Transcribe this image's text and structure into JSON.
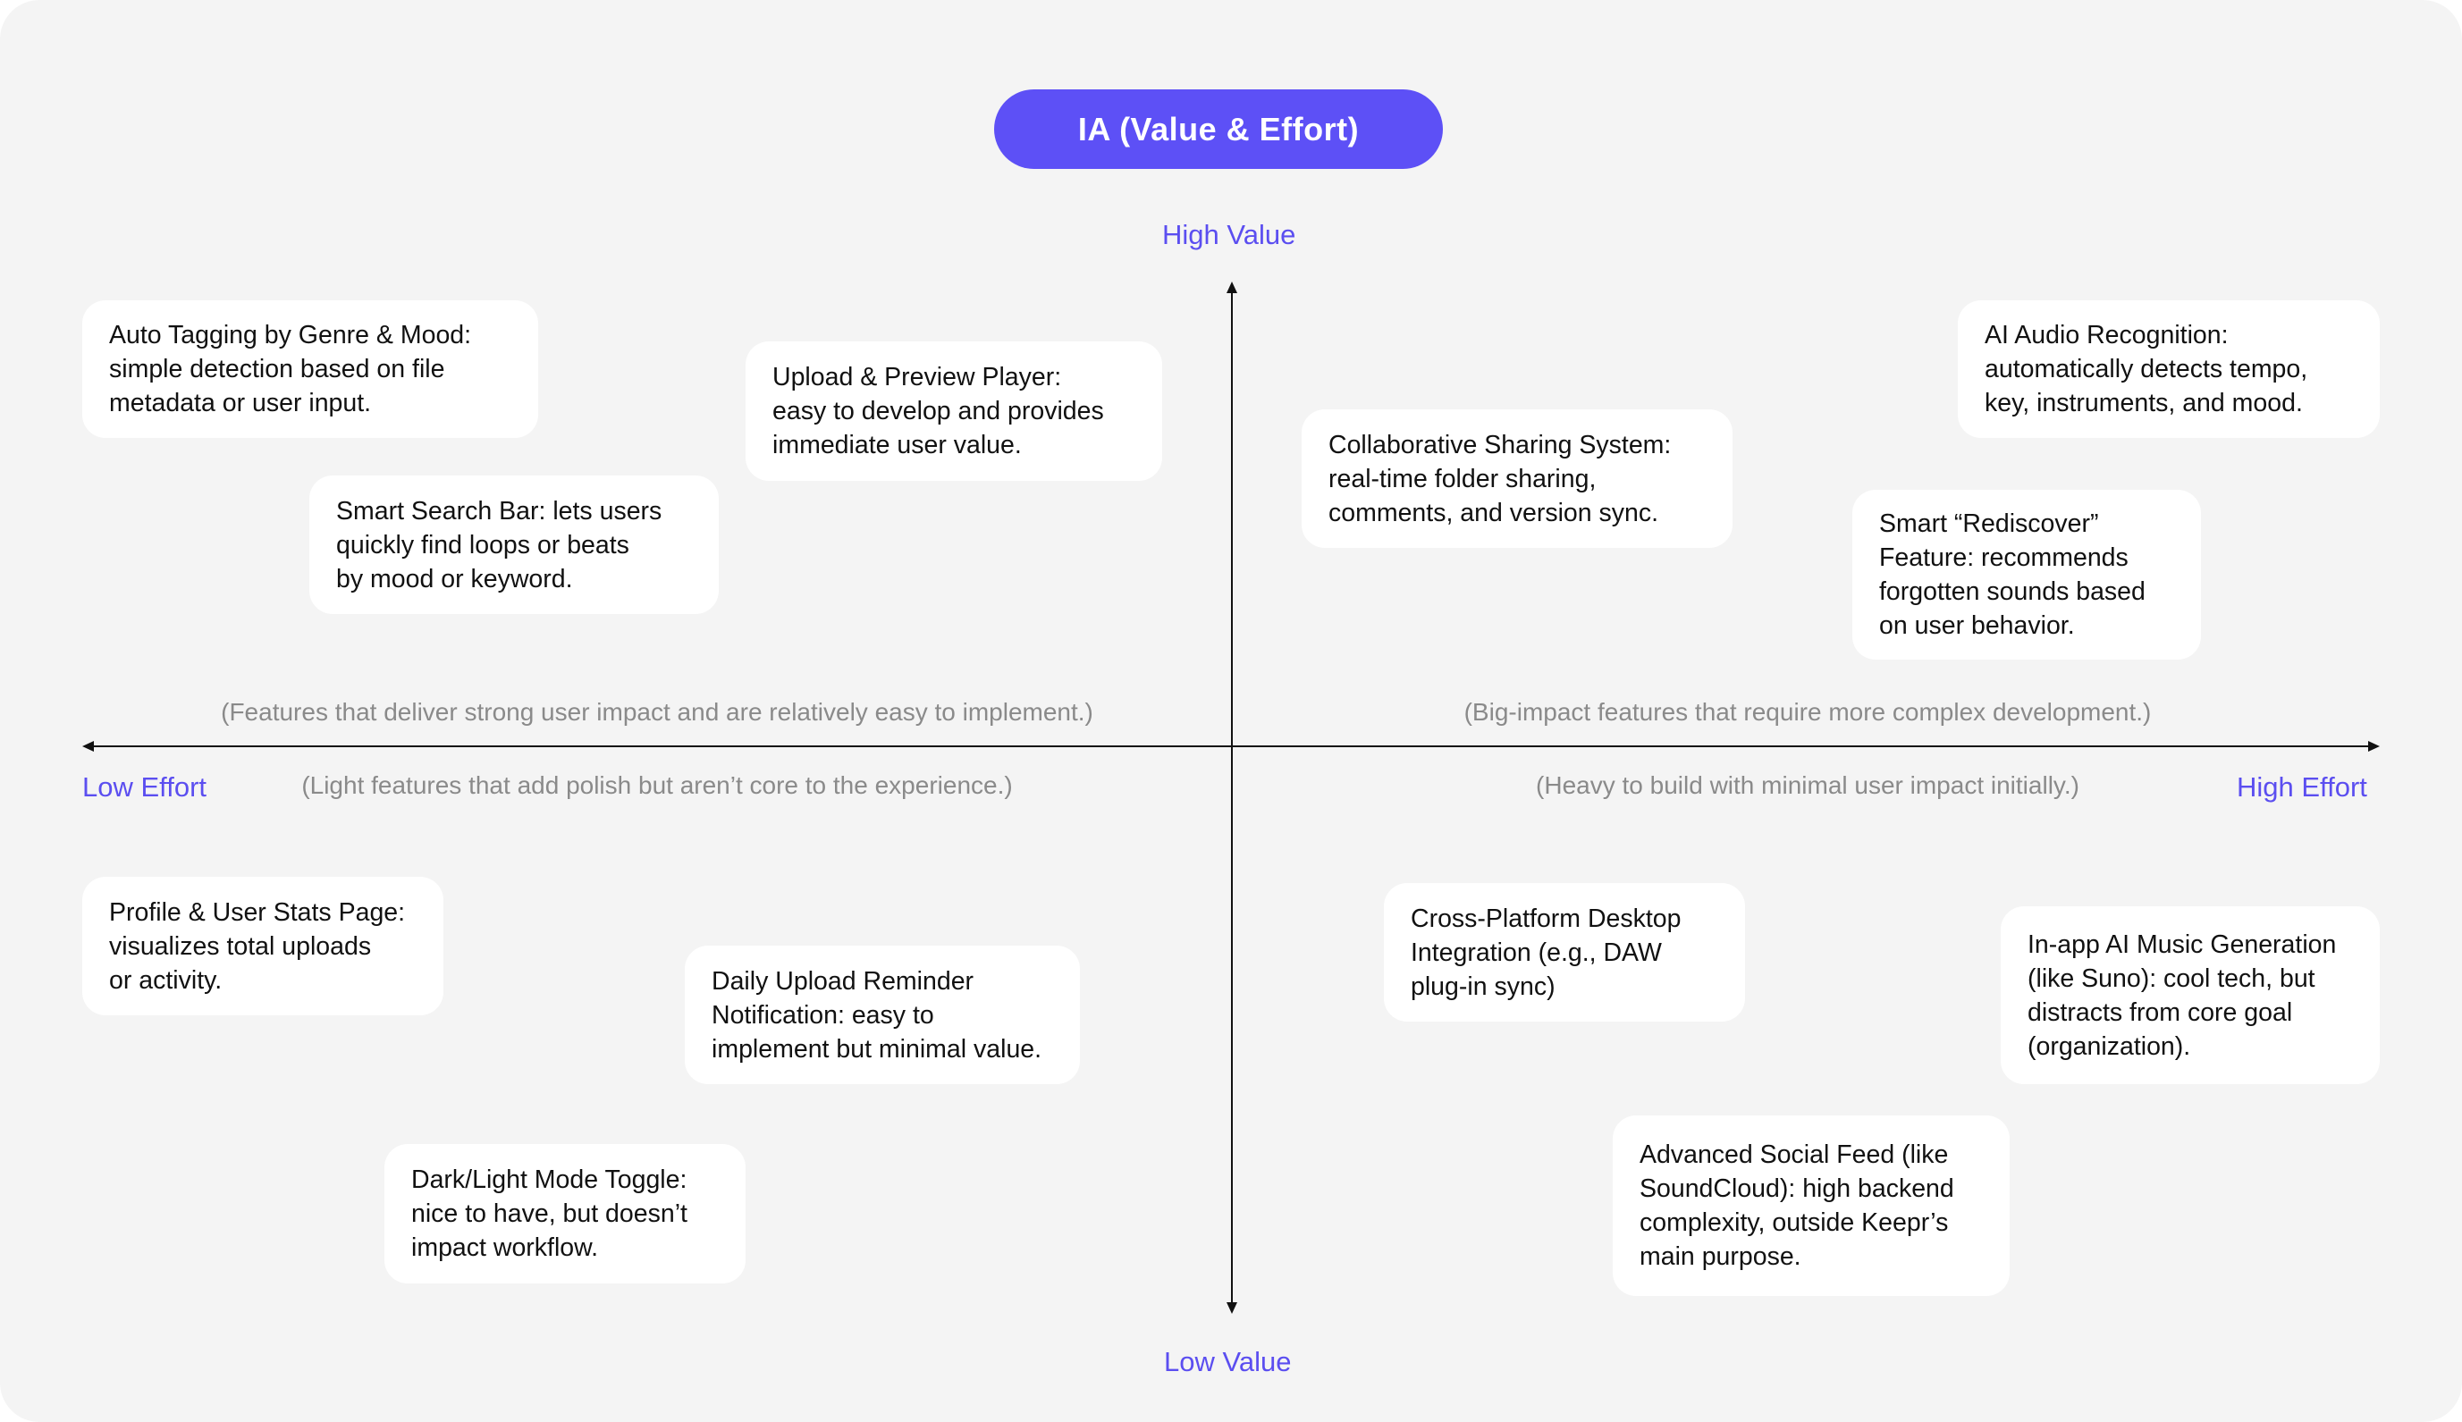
{
  "title": "IA (Value & Effort)",
  "axes": {
    "top": "High Value",
    "bottom": "Low Value",
    "left": "Low Effort",
    "right": "High Effort"
  },
  "quadrant_notes": {
    "top_left": "(Features that deliver strong user impact and are relatively easy to implement.)",
    "top_right": "(Big-impact features that require more complex development.)",
    "bottom_left": "(Light features that add polish but aren’t core to the experience.)",
    "bottom_right": "(Heavy to build with minimal user impact initially.)"
  },
  "cards": [
    {
      "id": "auto-tagging",
      "lines": [
        "Auto Tagging by Genre & Mood:",
        "simple detection based on file",
        "metadata or user input."
      ]
    },
    {
      "id": "upload-preview",
      "lines": [
        "Upload & Preview Player:",
        "easy to develop and provides",
        "immediate user value."
      ]
    },
    {
      "id": "smart-search",
      "lines": [
        "Smart Search Bar: lets users",
        "quickly find loops or beats",
        "by mood or keyword."
      ]
    },
    {
      "id": "collaborative-sharing",
      "lines": [
        "Collaborative Sharing System:",
        "real-time folder sharing,",
        "comments, and version sync."
      ]
    },
    {
      "id": "ai-audio-recognition",
      "lines": [
        "AI Audio Recognition:",
        "automatically detects tempo,",
        "key, instruments, and mood."
      ]
    },
    {
      "id": "smart-rediscover",
      "lines": [
        "Smart “Rediscover”",
        "Feature: recommends",
        "forgotten sounds based",
        "on user behavior."
      ]
    },
    {
      "id": "profile-stats",
      "lines": [
        "Profile & User Stats Page:",
        "visualizes total uploads",
        "or activity."
      ]
    },
    {
      "id": "daily-reminder",
      "lines": [
        "Daily Upload Reminder",
        "Notification: easy to",
        "implement but minimal value."
      ]
    },
    {
      "id": "dark-light-toggle",
      "lines": [
        "Dark/Light Mode Toggle:",
        "nice to have, but doesn’t",
        "impact workflow."
      ]
    },
    {
      "id": "cross-platform",
      "lines": [
        "Cross-Platform Desktop",
        "Integration (e.g., DAW",
        "plug-in sync)"
      ]
    },
    {
      "id": "ai-music-generation",
      "lines": [
        "In-app AI Music Generation",
        "(like Suno): cool tech, but",
        "distracts from core goal",
        "(organization)."
      ]
    },
    {
      "id": "social-feed",
      "lines": [
        "Advanced Social Feed (like",
        "SoundCloud): high backend",
        "complexity, outside Keepr’s",
        "main purpose."
      ]
    }
  ],
  "colors": {
    "accent": "#5d50f6",
    "axis_label": "#5b4ef0",
    "note_text": "#8a8a8a",
    "background": "#f4f4f4",
    "card": "#ffffff"
  }
}
